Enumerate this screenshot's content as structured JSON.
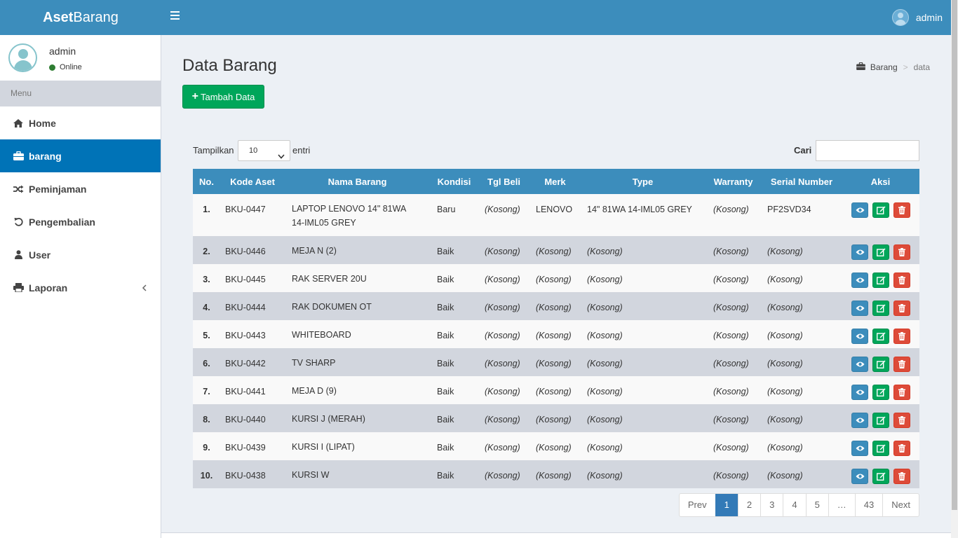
{
  "brand": {
    "bold": "Aset",
    "thin": "Barang"
  },
  "header_user": "admin",
  "sidebar": {
    "user_name": "admin",
    "status": "Online",
    "menu_header": "Menu",
    "items": [
      {
        "label": "Home",
        "icon": "home-icon"
      },
      {
        "label": "barang",
        "icon": "briefcase-icon"
      },
      {
        "label": "Peminjaman",
        "icon": "shuffle-icon"
      },
      {
        "label": "Pengembalian",
        "icon": "undo-icon"
      },
      {
        "label": "User",
        "icon": "user-icon"
      },
      {
        "label": "Laporan",
        "icon": "print-icon"
      }
    ]
  },
  "page": {
    "title": "Data Barang",
    "breadcrumb": {
      "parent": "Barang",
      "current": "data"
    },
    "add_button": "Tambah Data"
  },
  "table_controls": {
    "show_label": "Tampilkan",
    "length_value": "10",
    "entries_label": "entri",
    "search_label": "Cari"
  },
  "columns": [
    "No.",
    "Kode Aset",
    "Nama Barang",
    "Kondisi",
    "Tgl Beli",
    "Merk",
    "Type",
    "Warranty",
    "Serial Number",
    "Aksi"
  ],
  "rows": [
    {
      "no": "1.",
      "kode": "BKU-0447",
      "nama": "LAPTOP LENOVO 14\" 81WA 14-IML05 GREY",
      "kondisi": "Baru",
      "tgl": "(Kosong)",
      "merk": "LENOVO",
      "type": "14\" 81WA 14-IML05 GREY",
      "warranty": "(Kosong)",
      "serial": "PF2SVD34"
    },
    {
      "no": "2.",
      "kode": "BKU-0446",
      "nama": "MEJA N (2)",
      "kondisi": "Baik",
      "tgl": "(Kosong)",
      "merk": "(Kosong)",
      "type": "(Kosong)",
      "warranty": "(Kosong)",
      "serial": "(Kosong)"
    },
    {
      "no": "3.",
      "kode": "BKU-0445",
      "nama": "RAK SERVER 20U",
      "kondisi": "Baik",
      "tgl": "(Kosong)",
      "merk": "(Kosong)",
      "type": "(Kosong)",
      "warranty": "(Kosong)",
      "serial": "(Kosong)"
    },
    {
      "no": "4.",
      "kode": "BKU-0444",
      "nama": "RAK DOKUMEN OT",
      "kondisi": "Baik",
      "tgl": "(Kosong)",
      "merk": "(Kosong)",
      "type": "(Kosong)",
      "warranty": "(Kosong)",
      "serial": "(Kosong)"
    },
    {
      "no": "5.",
      "kode": "BKU-0443",
      "nama": "WHITEBOARD",
      "kondisi": "Baik",
      "tgl": "(Kosong)",
      "merk": "(Kosong)",
      "type": "(Kosong)",
      "warranty": "(Kosong)",
      "serial": "(Kosong)"
    },
    {
      "no": "6.",
      "kode": "BKU-0442",
      "nama": "TV SHARP",
      "kondisi": "Baik",
      "tgl": "(Kosong)",
      "merk": "(Kosong)",
      "type": "(Kosong)",
      "warranty": "(Kosong)",
      "serial": "(Kosong)"
    },
    {
      "no": "7.",
      "kode": "BKU-0441",
      "nama": "MEJA D (9)",
      "kondisi": "Baik",
      "tgl": "(Kosong)",
      "merk": "(Kosong)",
      "type": "(Kosong)",
      "warranty": "(Kosong)",
      "serial": "(Kosong)"
    },
    {
      "no": "8.",
      "kode": "BKU-0440",
      "nama": "KURSI J (MERAH)",
      "kondisi": "Baik",
      "tgl": "(Kosong)",
      "merk": "(Kosong)",
      "type": "(Kosong)",
      "warranty": "(Kosong)",
      "serial": "(Kosong)"
    },
    {
      "no": "9.",
      "kode": "BKU-0439",
      "nama": "KURSI I (LIPAT)",
      "kondisi": "Baik",
      "tgl": "(Kosong)",
      "merk": "(Kosong)",
      "type": "(Kosong)",
      "warranty": "(Kosong)",
      "serial": "(Kosong)"
    },
    {
      "no": "10.",
      "kode": "BKU-0438",
      "nama": "KURSI W",
      "kondisi": "Baik",
      "tgl": "(Kosong)",
      "merk": "(Kosong)",
      "type": "(Kosong)",
      "warranty": "(Kosong)",
      "serial": "(Kosong)"
    }
  ],
  "pagination": [
    "Prev",
    "1",
    "2",
    "3",
    "4",
    "5",
    "…",
    "43",
    "Next"
  ],
  "pagination_active": "1",
  "colors": {
    "header": "#3c8dbc",
    "active_menu": "#0073b7",
    "success": "#00a65a",
    "danger": "#dd4b39"
  }
}
